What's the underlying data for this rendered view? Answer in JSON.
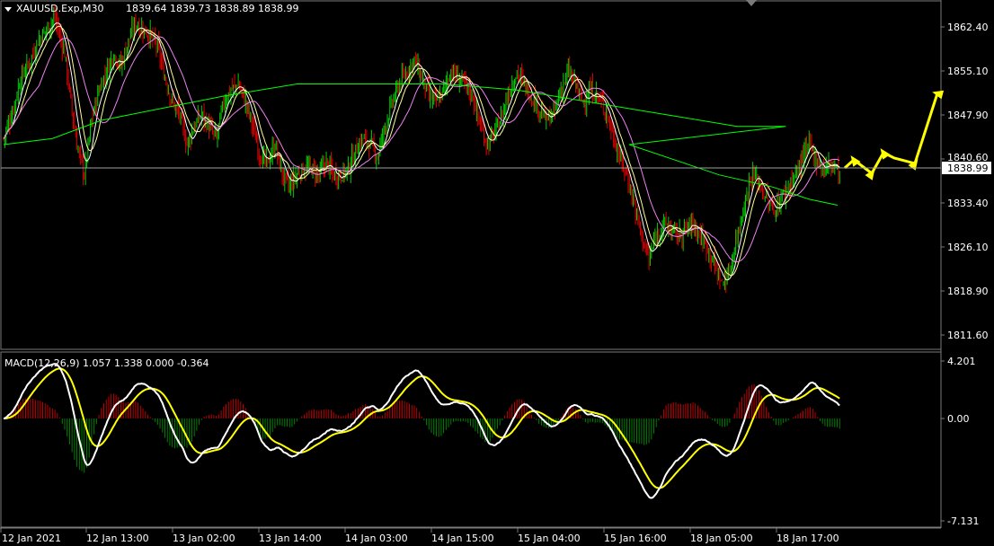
{
  "header": {
    "symbol_info": "XAUUSD.Exp,M30",
    "ohlc": "1839.64 1839.73 1838.89 1838.99"
  },
  "price_axis": {
    "ticks": [
      "1862.40",
      "1855.10",
      "1847.90",
      "1840.60",
      "1833.40",
      "1826.10",
      "1818.90",
      "1811.60"
    ],
    "current_price": "1838.99"
  },
  "macd_panel": {
    "label": "MACD(12,26,9) 1.057 1.338 0.000 -0.364",
    "ticks": [
      "4.201",
      "0.00",
      "-7.131"
    ]
  },
  "time_axis": {
    "labels": [
      "12 Jan 2021",
      "12 Jan 13:00",
      "13 Jan 02:00",
      "13 Jan 14:00",
      "14 Jan 03:00",
      "14 Jan 15:00",
      "15 Jan 04:00",
      "15 Jan 16:00",
      "18 Jan 05:00",
      "18 Jan 17:00"
    ]
  },
  "colors": {
    "background": "#000000",
    "bull": "#00d000",
    "bear": "#e00000",
    "ma_fast": "#ffffff",
    "ma_mid": "#ffff99",
    "ma_slow": "#ee82ee",
    "ma_long": "#00ff00",
    "macd_line": "#ffffff",
    "signal_line": "#ffff00",
    "hist_pos": "#c00000",
    "hist_neg": "#008000",
    "forecast": "#ffff00",
    "price_line": "#a0a0a0"
  },
  "chart_data": {
    "type": "candlestick",
    "symbol": "XAUUSD.Exp",
    "timeframe": "M30",
    "price_range": [
      1808.5,
      1866.8
    ],
    "macd_range": [
      -7.131,
      4.201
    ],
    "close_path": [
      [
        0,
        1844
      ],
      [
        8,
        1849
      ],
      [
        14,
        1854
      ],
      [
        20,
        1856
      ],
      [
        28,
        1860
      ],
      [
        35,
        1862
      ],
      [
        42,
        1864
      ],
      [
        50,
        1858
      ],
      [
        55,
        1850
      ],
      [
        60,
        1843
      ],
      [
        66,
        1838
      ],
      [
        72,
        1847
      ],
      [
        78,
        1852
      ],
      [
        84,
        1855
      ],
      [
        90,
        1858
      ],
      [
        96,
        1856
      ],
      [
        102,
        1860
      ],
      [
        108,
        1863
      ],
      [
        114,
        1862
      ],
      [
        120,
        1861
      ],
      [
        126,
        1859
      ],
      [
        132,
        1854
      ],
      [
        138,
        1850
      ],
      [
        144,
        1848
      ],
      [
        150,
        1843
      ],
      [
        156,
        1846
      ],
      [
        162,
        1848
      ],
      [
        168,
        1846
      ],
      [
        174,
        1844
      ],
      [
        180,
        1850
      ],
      [
        186,
        1852
      ],
      [
        192,
        1853
      ],
      [
        198,
        1850
      ],
      [
        204,
        1846
      ],
      [
        210,
        1841
      ],
      [
        216,
        1840
      ],
      [
        222,
        1843
      ],
      [
        228,
        1838
      ],
      [
        234,
        1836
      ],
      [
        240,
        1838
      ],
      [
        246,
        1839
      ],
      [
        252,
        1839
      ],
      [
        258,
        1838
      ],
      [
        264,
        1840
      ],
      [
        270,
        1838
      ],
      [
        276,
        1838
      ],
      [
        282,
        1839
      ],
      [
        288,
        1842
      ],
      [
        294,
        1844
      ],
      [
        300,
        1843
      ],
      [
        306,
        1841
      ],
      [
        312,
        1846
      ],
      [
        318,
        1850
      ],
      [
        324,
        1853
      ],
      [
        330,
        1855
      ],
      [
        336,
        1857
      ],
      [
        342,
        1854
      ],
      [
        348,
        1851
      ],
      [
        354,
        1850
      ],
      [
        360,
        1852
      ],
      [
        366,
        1855
      ],
      [
        372,
        1854
      ],
      [
        378,
        1853
      ],
      [
        384,
        1851
      ],
      [
        390,
        1846
      ],
      [
        396,
        1843
      ],
      [
        402,
        1845
      ],
      [
        408,
        1848
      ],
      [
        414,
        1852
      ],
      [
        420,
        1855
      ],
      [
        426,
        1853
      ],
      [
        432,
        1851
      ],
      [
        438,
        1849
      ],
      [
        444,
        1847
      ],
      [
        450,
        1848
      ],
      [
        456,
        1852
      ],
      [
        462,
        1855
      ],
      [
        468,
        1853
      ],
      [
        474,
        1850
      ],
      [
        480,
        1852
      ],
      [
        486,
        1851
      ],
      [
        492,
        1849
      ],
      [
        498,
        1845
      ],
      [
        504,
        1841
      ],
      [
        510,
        1838
      ],
      [
        516,
        1833
      ],
      [
        522,
        1828
      ],
      [
        528,
        1824
      ],
      [
        534,
        1828
      ],
      [
        540,
        1830
      ],
      [
        546,
        1829
      ],
      [
        552,
        1828
      ],
      [
        558,
        1829
      ],
      [
        564,
        1830
      ],
      [
        570,
        1828
      ],
      [
        576,
        1826
      ],
      [
        582,
        1823
      ],
      [
        588,
        1820
      ],
      [
        594,
        1822
      ],
      [
        600,
        1828
      ],
      [
        606,
        1833
      ],
      [
        612,
        1838
      ],
      [
        618,
        1837
      ],
      [
        624,
        1834
      ],
      [
        630,
        1832
      ],
      [
        636,
        1834
      ],
      [
        642,
        1836
      ],
      [
        648,
        1838
      ],
      [
        654,
        1841
      ],
      [
        660,
        1843
      ],
      [
        666,
        1840
      ],
      [
        672,
        1839
      ],
      [
        678,
        1840
      ],
      [
        684,
        1838
      ]
    ],
    "ma_long_path": [
      [
        0,
        1843
      ],
      [
        40,
        1844
      ],
      [
        80,
        1847
      ],
      [
        130,
        1849
      ],
      [
        180,
        1851
      ],
      [
        240,
        1853
      ],
      [
        300,
        1853
      ],
      [
        360,
        1853
      ],
      [
        420,
        1852
      ],
      [
        480,
        1850
      ],
      [
        540,
        1848
      ],
      [
        600,
        1846
      ],
      [
        640,
        1846
      ],
      [
        700,
        1843
      ],
      [
        760,
        1840
      ],
      [
        800,
        1838
      ],
      [
        860,
        1836
      ],
      [
        900,
        1834
      ],
      [
        932,
        1833
      ]
    ]
  }
}
